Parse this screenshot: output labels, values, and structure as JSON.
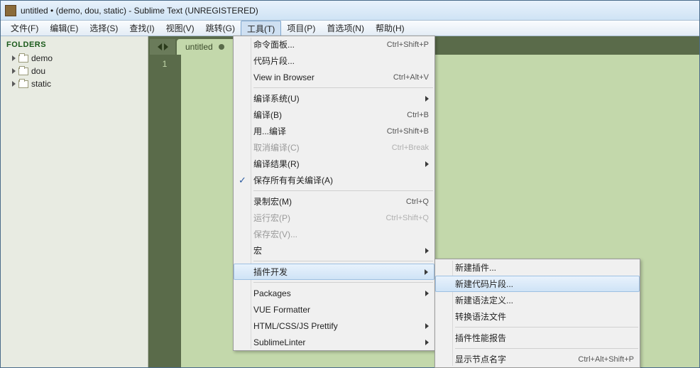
{
  "title": "untitled • (demo, dou, static) - Sublime Text (UNREGISTERED)",
  "menubar": [
    "文件(F)",
    "编辑(E)",
    "选择(S)",
    "查找(I)",
    "视图(V)",
    "跳转(G)",
    "工具(T)",
    "项目(P)",
    "首选项(N)",
    "帮助(H)"
  ],
  "menubar_open": 6,
  "sidebar": {
    "header": "FOLDERS",
    "items": [
      "demo",
      "dou",
      "static"
    ]
  },
  "tab": {
    "label": "untitled"
  },
  "gutter_line": "1",
  "tools_menu": [
    {
      "type": "item",
      "label": "命令面板...",
      "shortcut": "Ctrl+Shift+P"
    },
    {
      "type": "item",
      "label": "代码片段..."
    },
    {
      "type": "item",
      "label": "View in Browser",
      "shortcut": "Ctrl+Alt+V"
    },
    {
      "type": "sep"
    },
    {
      "type": "item",
      "label": "编译系统(U)",
      "submenu": true
    },
    {
      "type": "item",
      "label": "编译(B)",
      "shortcut": "Ctrl+B"
    },
    {
      "type": "item",
      "label": "用...编译",
      "shortcut": "Ctrl+Shift+B"
    },
    {
      "type": "item",
      "label": "取消编译(C)",
      "shortcut": "Ctrl+Break",
      "disabled": true
    },
    {
      "type": "item",
      "label": "编译结果(R)",
      "submenu": true
    },
    {
      "type": "item",
      "label": "保存所有有关编译(A)",
      "checked": true
    },
    {
      "type": "sep"
    },
    {
      "type": "item",
      "label": "录制宏(M)",
      "shortcut": "Ctrl+Q"
    },
    {
      "type": "item",
      "label": "运行宏(P)",
      "shortcut": "Ctrl+Shift+Q",
      "disabled": true
    },
    {
      "type": "item",
      "label": "保存宏(V)...",
      "disabled": true
    },
    {
      "type": "item",
      "label": "宏",
      "submenu": true
    },
    {
      "type": "sep"
    },
    {
      "type": "item",
      "label": "插件开发",
      "submenu": true,
      "hover": true
    },
    {
      "type": "sep"
    },
    {
      "type": "item",
      "label": "Packages",
      "submenu": true
    },
    {
      "type": "item",
      "label": "VUE Formatter"
    },
    {
      "type": "item",
      "label": "HTML/CSS/JS Prettify",
      "submenu": true
    },
    {
      "type": "item",
      "label": "SublimeLinter",
      "submenu": true
    }
  ],
  "submenu": [
    {
      "type": "item",
      "label": "新建插件..."
    },
    {
      "type": "item",
      "label": "新建代码片段...",
      "hover": true
    },
    {
      "type": "item",
      "label": "新建语法定义..."
    },
    {
      "type": "item",
      "label": "转换语法文件"
    },
    {
      "type": "sep"
    },
    {
      "type": "item",
      "label": "插件性能报告"
    },
    {
      "type": "sep"
    },
    {
      "type": "item",
      "label": "显示节点名字",
      "shortcut": "Ctrl+Alt+Shift+P"
    }
  ]
}
